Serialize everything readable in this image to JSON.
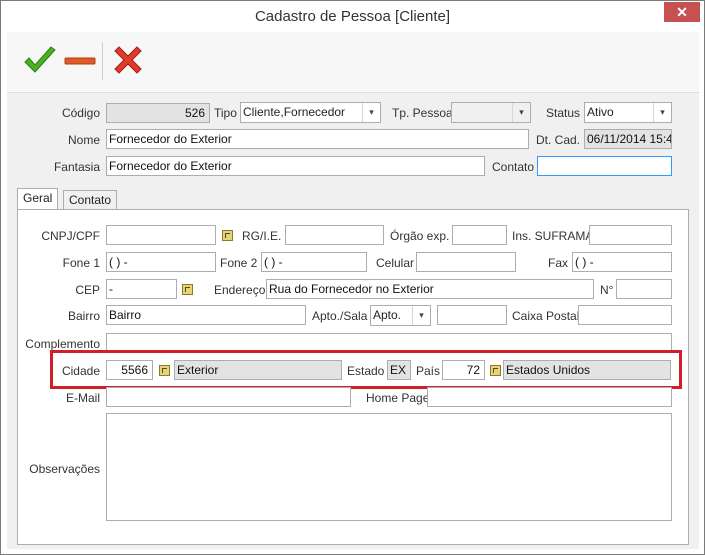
{
  "window": {
    "title": "Cadastro de Pessoa [Cliente]",
    "close_label": "✕"
  },
  "toolbar": {
    "confirm_icon": "checkmark-icon",
    "minus_icon": "minus-icon",
    "cancel_icon": "x-icon"
  },
  "header": {
    "codigo_label": "Código",
    "codigo_value": "526",
    "tipo_label": "Tipo",
    "tipo_value": "Cliente,Fornecedor",
    "tp_pessoa_label": "Tp. Pessoa",
    "tp_pessoa_value": "",
    "status_label": "Status",
    "status_value": "Ativo",
    "nome_label": "Nome",
    "nome_value": "Fornecedor do Exterior",
    "dt_cad_label": "Dt. Cad.",
    "dt_cad_value": "06/11/2014 15:4",
    "fantasia_label": "Fantasia",
    "fantasia_value": "Fornecedor do Exterior",
    "contato_label": "Contato",
    "contato_value": ""
  },
  "tabs": [
    "Geral",
    "Contato"
  ],
  "geral": {
    "cnpj_label": "CNPJ/CPF",
    "cnpj_value": "",
    "rg_label": "RG/I.E.",
    "rg_value": "",
    "orgao_label": "Órgão exp.",
    "orgao_value": "",
    "suframa_label": "Ins. SUFRAMA",
    "suframa_value": "",
    "fone1_label": "Fone 1",
    "fone1_value": "(  )    -",
    "fone2_label": "Fone 2",
    "fone2_value": "(  )    -",
    "celular_label": "Celular",
    "celular_value": "",
    "fax_label": "Fax",
    "fax_value": "(  )    -",
    "cep_label": "CEP",
    "cep_value": "     -",
    "endereco_label": "Endereço",
    "endereco_value": "Rua do Fornecedor no Exterior",
    "numero_label": "N°",
    "numero_value": "",
    "bairro_label": "Bairro",
    "bairro_value": "Bairro",
    "apto_label": "Apto./Sala",
    "apto_select": "Apto.",
    "apto_value": "",
    "caixa_label": "Caixa Postal",
    "caixa_value": "",
    "complemento_label": "Complemento",
    "complemento_value": "",
    "cidade_label": "Cidade",
    "cidade_code": "5566",
    "cidade_name": "Exterior",
    "estado_label": "Estado",
    "estado_value": "EX",
    "pais_label": "País",
    "pais_code": "72",
    "pais_name": "Estados Unidos",
    "email_label": "E-Mail",
    "email_value": "",
    "homepage_label": "Home Page",
    "homepage_value": "",
    "obs_label": "Observações",
    "obs_value": ""
  },
  "colors": {
    "highlight": "#d01f2a",
    "confirm": "#4caf1e",
    "cancel": "#e03a2b",
    "minus": "#e05a2b"
  }
}
